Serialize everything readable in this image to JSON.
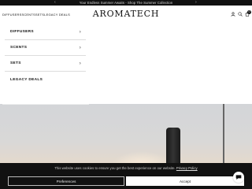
{
  "announcement": {
    "text": "Your Endless Summer Awaits - Shop The Summer Collection",
    "prev_icon": "chevron-left-icon",
    "next_icon": "chevron-right-icon"
  },
  "header": {
    "nav": [
      "DIFFUSERS",
      "SCENTS",
      "SETS",
      "LEGACY DEALS"
    ],
    "logo": "AROMATECH",
    "icons": [
      "user-icon",
      "search-icon",
      "cart-icon"
    ],
    "cart_count": "0"
  },
  "menu": {
    "items": [
      {
        "label": "DIFFUSERS",
        "has_submenu": true
      },
      {
        "label": "SCENTS",
        "has_submenu": true
      },
      {
        "label": "SETS",
        "has_submenu": true
      },
      {
        "label": "LEGACY DEALS",
        "has_submenu": false
      }
    ],
    "chevron": "›"
  },
  "cookie": {
    "text": "This website uses cookies to ensure you get the best experience on our website.",
    "policy_link": "Privacy Policy",
    "preferences_label": "Preferences",
    "accept_label": "Accept"
  },
  "chat": {
    "icon": "chat-bubble-icon"
  }
}
